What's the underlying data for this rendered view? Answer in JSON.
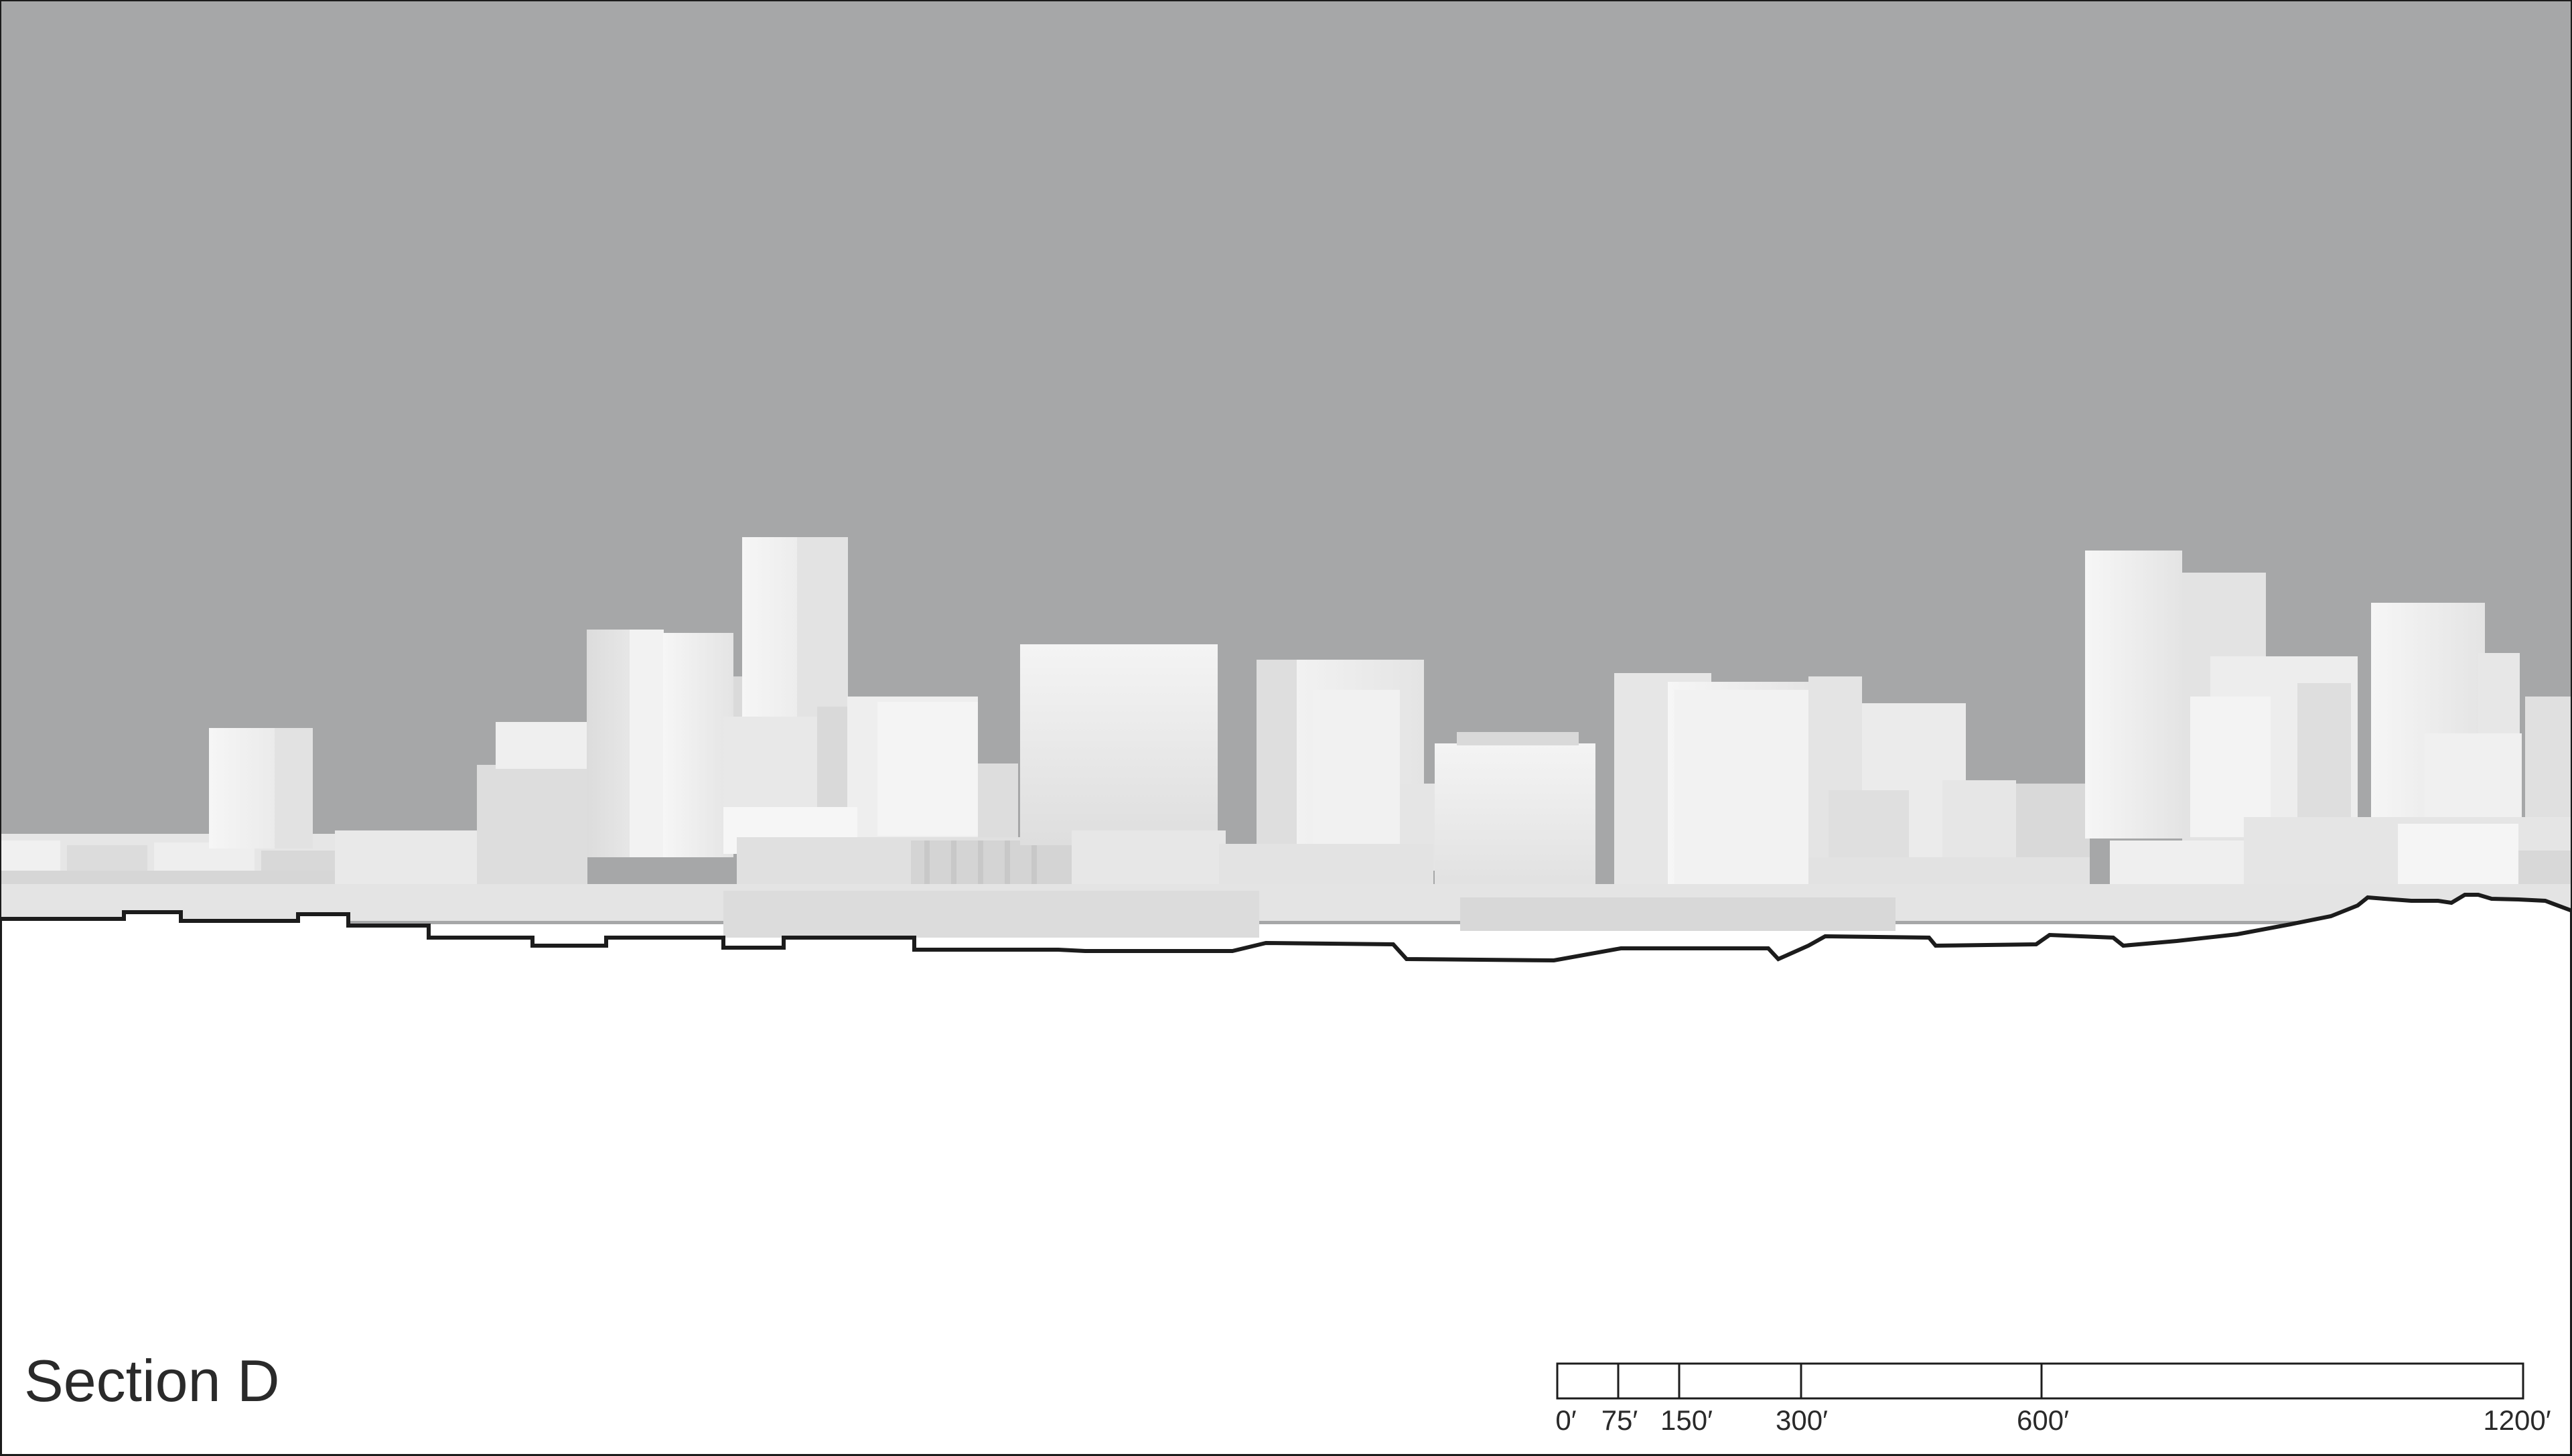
{
  "title": "Section D",
  "colors": {
    "sky": "#a6a7a8",
    "building_light": "#f2f2f2",
    "building_shadow": "#d2d2d2",
    "ground": "#ffffff",
    "ground_line": "#1c1c1c",
    "text": "#2a2a2a"
  },
  "scale_bar": {
    "ticks": [
      "0′",
      "75′",
      "150′",
      "300′",
      "600′",
      "1200′"
    ],
    "tick_values_ft": [
      0,
      75,
      150,
      300,
      600,
      1200
    ],
    "unit": "feet"
  }
}
